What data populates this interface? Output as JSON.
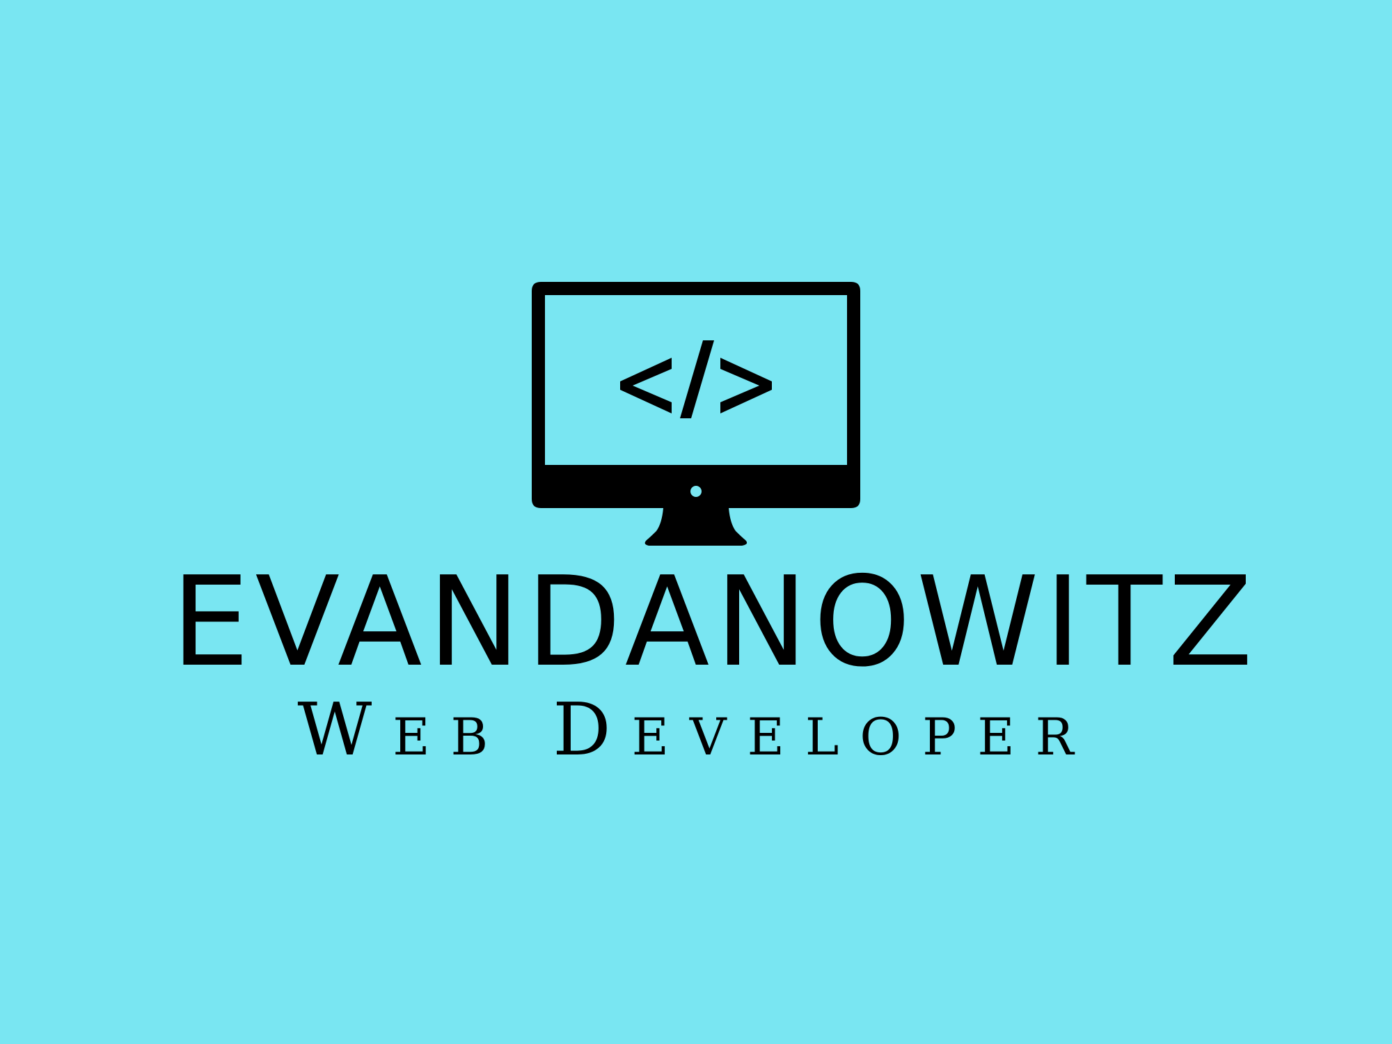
{
  "logo": {
    "icon": "monitor-with-code-icon",
    "screen_text": "</>",
    "name": "EVANDANOWITZ",
    "tagline": "Web Developer"
  },
  "colors": {
    "background": "#79e6f2",
    "foreground": "#000000"
  }
}
